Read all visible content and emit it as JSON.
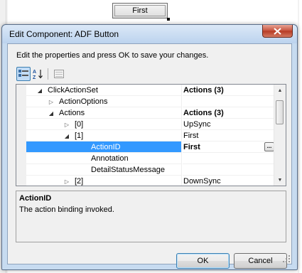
{
  "canvas_button": {
    "label": "First"
  },
  "dialog": {
    "title": "Edit Component: ADF Button",
    "prompt": "Edit the properties and press OK to save your changes.",
    "toolbar": {
      "categorized_icon": "categorized-icon",
      "alphabetical_icon": "sort-az-icon",
      "property_pages_icon": "property-pages-icon"
    },
    "grid": {
      "rows": [
        {
          "name": "ClickActionSet",
          "value": "Actions (3)",
          "indent": 0,
          "expander": "open"
        },
        {
          "name": "ActionOptions",
          "value": "",
          "indent": 1,
          "expander": "closed"
        },
        {
          "name": "Actions",
          "value": "Actions (3)",
          "indent": 1,
          "expander": "open"
        },
        {
          "name": "[0]",
          "value": "UpSync",
          "indent": 2,
          "expander": "closed"
        },
        {
          "name": "[1]",
          "value": "First",
          "indent": 2,
          "expander": "open"
        },
        {
          "name": "ActionID",
          "value": "First",
          "indent": 3,
          "expander": ""
        },
        {
          "name": "Annotation",
          "value": "",
          "indent": 3,
          "expander": ""
        },
        {
          "name": "DetailStatusMessage",
          "value": "",
          "indent": 3,
          "expander": ""
        },
        {
          "name": "[2]",
          "value": "DownSync",
          "indent": 2,
          "expander": "closed"
        }
      ],
      "ellipsis_label": "..."
    },
    "description": {
      "title": "ActionID",
      "text": "The action binding invoked."
    },
    "buttons": {
      "ok": "OK",
      "cancel": "Cancel"
    }
  },
  "colors": {
    "selection": "#3399ff",
    "titlebar": "#bcd3ee",
    "close_button": "#c5503a"
  }
}
